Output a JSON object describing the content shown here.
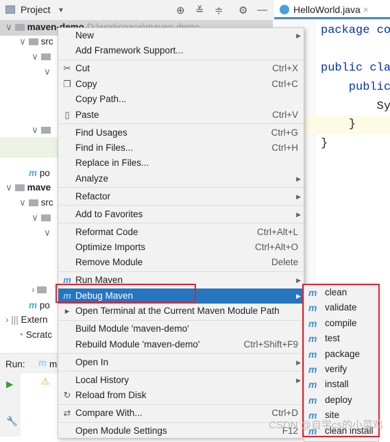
{
  "project_panel": {
    "title": "Project",
    "icons": [
      "locate-icon",
      "expand-all-icon",
      "collapse-all-icon",
      "gear-icon",
      "minimize-icon"
    ],
    "tree": [
      {
        "label": "maven-demo",
        "path": "D:\\workspace\\maven-demo"
      },
      {
        "label": "src"
      },
      {
        "label": "po"
      },
      {
        "label": "mave"
      },
      {
        "label": "src"
      },
      {
        "label": "po"
      },
      {
        "label": "Extern"
      },
      {
        "label": "Scratc"
      }
    ]
  },
  "editor": {
    "tab": "HelloWorld.java",
    "lines": [
      "package co",
      "",
      "public cla",
      "    public",
      "        Sy",
      "    }",
      "}"
    ]
  },
  "run_panel": {
    "label": "Run:",
    "tab": "m"
  },
  "context_menu": {
    "groups": [
      [
        {
          "label": "New",
          "submenu": true
        },
        {
          "label": "Add Framework Support..."
        }
      ],
      [
        {
          "label": "Cut",
          "shortcut": "Ctrl+X",
          "icon": "scissors-icon"
        },
        {
          "label": "Copy",
          "shortcut": "Ctrl+C",
          "icon": "copy-icon"
        },
        {
          "label": "Copy Path..."
        },
        {
          "label": "Paste",
          "shortcut": "Ctrl+V",
          "icon": "paste-icon"
        }
      ],
      [
        {
          "label": "Find Usages",
          "shortcut": "Ctrl+G"
        },
        {
          "label": "Find in Files...",
          "shortcut": "Ctrl+H"
        },
        {
          "label": "Replace in Files..."
        },
        {
          "label": "Analyze",
          "submenu": true
        }
      ],
      [
        {
          "label": "Refactor",
          "submenu": true
        }
      ],
      [
        {
          "label": "Add to Favorites",
          "submenu": true
        }
      ],
      [
        {
          "label": "Reformat Code",
          "shortcut": "Ctrl+Alt+L"
        },
        {
          "label": "Optimize Imports",
          "shortcut": "Ctrl+Alt+O"
        },
        {
          "label": "Remove Module",
          "shortcut": "Delete"
        }
      ],
      [
        {
          "label": "Run Maven",
          "submenu": true,
          "icon": "maven-icon"
        },
        {
          "label": "Debug Maven",
          "submenu": true,
          "icon": "maven-icon",
          "selected": true
        },
        {
          "label": "Open Terminal at the Current Maven Module Path",
          "icon": "terminal-icon"
        }
      ],
      [
        {
          "label": "Build Module 'maven-demo'"
        },
        {
          "label": "Rebuild Module 'maven-demo'",
          "shortcut": "Ctrl+Shift+F9"
        }
      ],
      [
        {
          "label": "Open In",
          "submenu": true
        }
      ],
      [
        {
          "label": "Local History",
          "submenu": true
        },
        {
          "label": "Reload from Disk",
          "icon": "reload-icon"
        }
      ],
      [
        {
          "label": "Compare With...",
          "shortcut": "Ctrl+D",
          "icon": "compare-icon"
        }
      ],
      [
        {
          "label": "Open Module Settings",
          "shortcut": "F12"
        }
      ]
    ]
  },
  "debug_maven_submenu": [
    "clean",
    "validate",
    "compile",
    "test",
    "package",
    "verify",
    "install",
    "deploy",
    "site",
    "clean install"
  ],
  "highlight_color": "#e8202a",
  "watermark": "CSDN @自学cs的小菜鸡"
}
